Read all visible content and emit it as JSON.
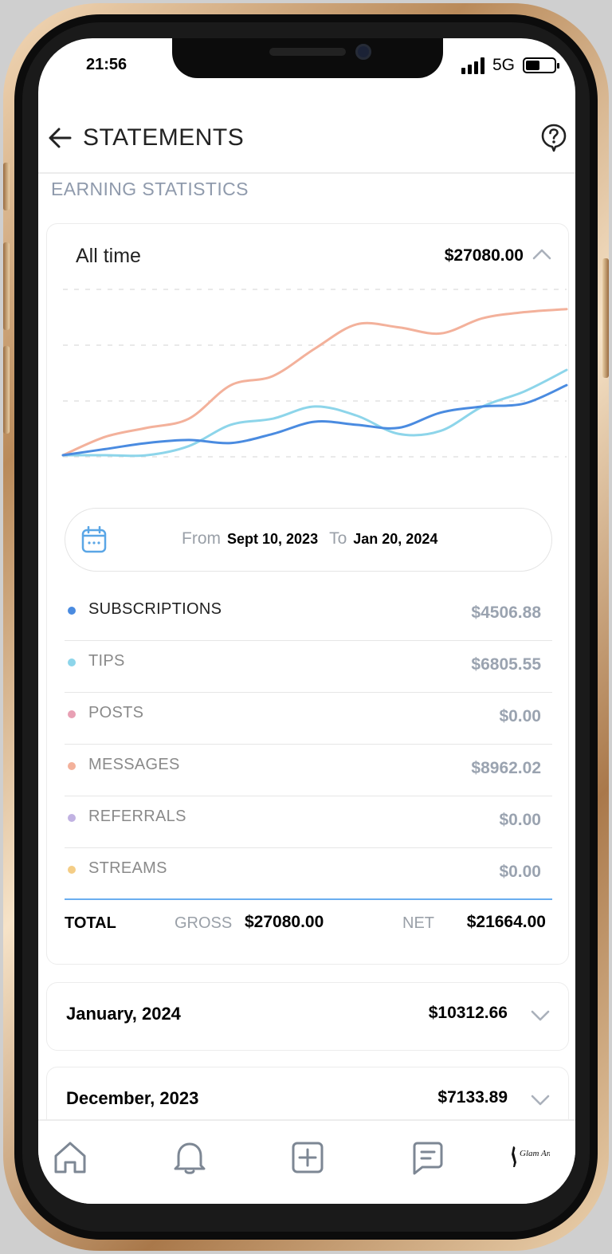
{
  "status_bar": {
    "time": "21:56",
    "network": "5G"
  },
  "header": {
    "title": "STATEMENTS"
  },
  "section_label": "EARNING STATISTICS",
  "summary_card": {
    "period": "All time",
    "amount": "$27080.00"
  },
  "date_range": {
    "from_label": "From",
    "from_value": "Sept 10, 2023",
    "to_label": "To",
    "to_value": "Jan 20, 2024"
  },
  "categories": [
    {
      "name": "SUBSCRIPTIONS",
      "value": "$4506.88",
      "color": "#4a8be0"
    },
    {
      "name": "TIPS",
      "value": "$6805.55",
      "color": "#8dd5ea"
    },
    {
      "name": "POSTS",
      "value": "$0.00",
      "color": "#e8a0b4"
    },
    {
      "name": "MESSAGES",
      "value": "$8962.02",
      "color": "#f3b19b"
    },
    {
      "name": "REFERRALS",
      "value": "$0.00",
      "color": "#c1b2e2"
    },
    {
      "name": "STREAMS",
      "value": "$0.00",
      "color": "#f4cd86"
    }
  ],
  "totals": {
    "label": "TOTAL",
    "gross_label": "GROSS",
    "gross_value": "$27080.00",
    "net_label": "NET",
    "net_value": "$21664.00"
  },
  "months": [
    {
      "name": "January, 2024",
      "amount": "$10312.66"
    },
    {
      "name": "December, 2023",
      "amount": "$7133.89"
    }
  ],
  "bottom_nav": {
    "brand_text": "Glam Angels"
  },
  "chart_data": {
    "type": "line",
    "x": [
      0,
      1,
      2,
      3,
      4,
      5,
      6,
      7,
      8,
      9,
      10,
      11,
      12
    ],
    "series": [
      {
        "name": "MESSAGES",
        "color": "#f3b19b",
        "values": [
          0,
          6,
          9,
          12,
          23,
          26,
          35,
          43,
          42,
          40,
          45,
          47,
          48
        ]
      },
      {
        "name": "TIPS",
        "color": "#8dd5ea",
        "values": [
          0,
          0,
          0,
          3,
          10,
          12,
          16,
          13,
          7,
          8,
          16,
          21,
          28
        ]
      },
      {
        "name": "SUBSCRIPTIONS",
        "color": "#4a8be0",
        "values": [
          0,
          2,
          4,
          5,
          4,
          7,
          11,
          10,
          9,
          14,
          16,
          17,
          23
        ]
      }
    ],
    "ylim": [
      0,
      55
    ],
    "grid": true,
    "legend": "none"
  }
}
